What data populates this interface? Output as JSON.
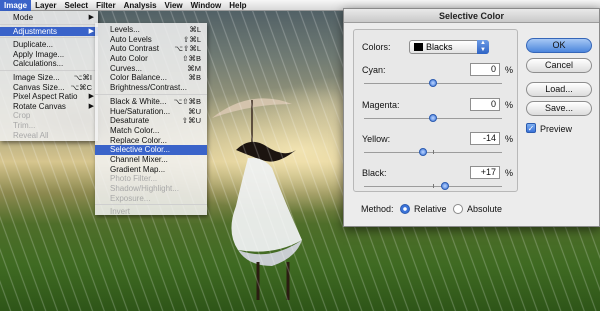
{
  "menubar": {
    "items": [
      "Image",
      "Layer",
      "Select",
      "Filter",
      "Analysis",
      "View",
      "Window",
      "Help"
    ],
    "active": "Image"
  },
  "image_menu": {
    "mode": "Mode",
    "adjustments": "Adjustments",
    "duplicate": "Duplicate...",
    "apply_image": "Apply Image...",
    "calculations": "Calculations...",
    "image_size": "Image Size...",
    "image_size_sc": "⌥⌘I",
    "canvas_size": "Canvas Size...",
    "canvas_size_sc": "⌥⌘C",
    "pixel_aspect": "Pixel Aspect Ratio",
    "rotate_canvas": "Rotate Canvas",
    "crop": "Crop",
    "trim": "Trim...",
    "reveal_all": "Reveal All"
  },
  "adjustments_menu": {
    "levels": "Levels...",
    "levels_sc": "⌘L",
    "auto_levels": "Auto Levels",
    "auto_levels_sc": "⇧⌘L",
    "auto_contrast": "Auto Contrast",
    "auto_contrast_sc": "⌥⇧⌘L",
    "auto_color": "Auto Color",
    "auto_color_sc": "⇧⌘B",
    "curves": "Curves...",
    "curves_sc": "⌘M",
    "color_balance": "Color Balance...",
    "color_balance_sc": "⌘B",
    "brightness_contrast": "Brightness/Contrast...",
    "black_white": "Black & White...",
    "black_white_sc": "⌥⇧⌘B",
    "hue_saturation": "Hue/Saturation...",
    "hue_saturation_sc": "⌘U",
    "desaturate": "Desaturate",
    "desaturate_sc": "⇧⌘U",
    "match_color": "Match Color...",
    "replace_color": "Replace Color...",
    "selective_color": "Selective Color...",
    "channel_mixer": "Channel Mixer...",
    "gradient_map": "Gradient Map...",
    "photo_filter": "Photo Filter...",
    "shadow_highlight": "Shadow/Highlight...",
    "exposure": "Exposure...",
    "invert": "Invert"
  },
  "dialog": {
    "title": "Selective Color",
    "colors_label": "Colors:",
    "colors_value": "Blacks",
    "cyan_label": "Cyan:",
    "cyan_value": "0",
    "magenta_label": "Magenta:",
    "magenta_value": "0",
    "yellow_label": "Yellow:",
    "yellow_value": "-14",
    "black_label": "Black:",
    "black_value": "+17",
    "percent": "%",
    "method_label": "Method:",
    "relative_label": "Relative",
    "absolute_label": "Absolute",
    "method_selected": "Relative",
    "ok_label": "OK",
    "cancel_label": "Cancel",
    "load_label": "Load...",
    "save_label": "Save...",
    "preview_label": "Preview",
    "preview_checked": true,
    "slider_values": {
      "cyan": 0,
      "magenta": 0,
      "yellow": -14,
      "black": 17
    }
  }
}
